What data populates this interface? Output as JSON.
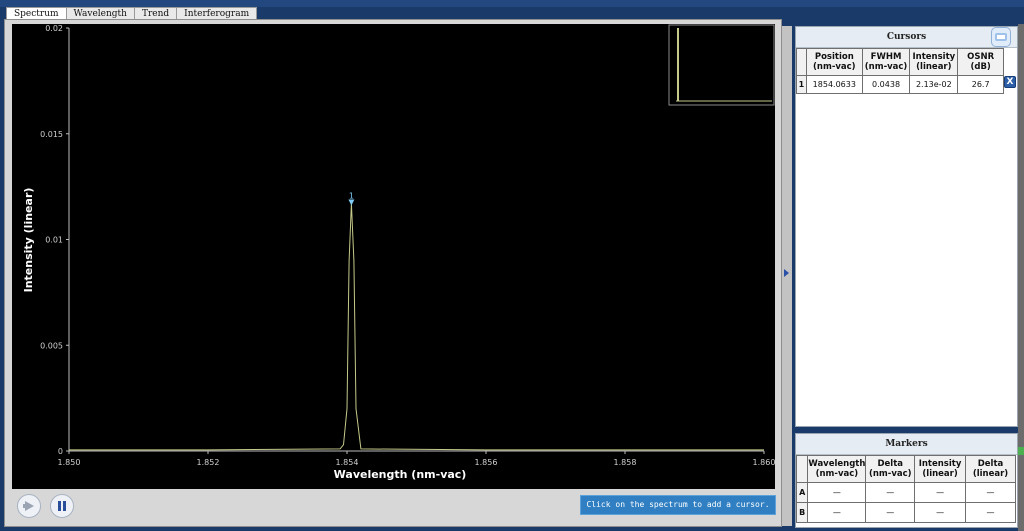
{
  "tabs": [
    "Spectrum",
    "Wavelength",
    "Trend",
    "Interferogram"
  ],
  "plot": {
    "ylabel": "Intensity (linear)",
    "xlabel": "Wavelength (nm-vac)",
    "yticks": [
      "0",
      "0.005",
      "0.01",
      "0.015",
      "0.02"
    ],
    "xticks": [
      "1.850",
      "1.852",
      "1.854",
      "1.856",
      "1.858",
      "1.860"
    ],
    "peak_marker_label": "1",
    "colors": {
      "background": "#000000",
      "trace": "#c6c98a",
      "marker": "#7ecaf3"
    }
  },
  "chart_data": {
    "type": "line",
    "xlabel": "Wavelength (nm-vac)",
    "ylabel": "Intensity (linear)",
    "xlim": [
      1850,
      1860
    ],
    "ylim": [
      0,
      0.02
    ],
    "x": [
      1850.0,
      1852.0,
      1853.9,
      1853.95,
      1854.0,
      1854.03,
      1854.0633,
      1854.1,
      1854.13,
      1854.2,
      1856.0,
      1858.0,
      1860.0
    ],
    "y": [
      5e-05,
      5e-05,
      0.0001,
      0.0003,
      0.002,
      0.009,
      0.0117,
      0.009,
      0.002,
      0.0001,
      5e-05,
      5e-05,
      5e-05
    ]
  },
  "controls": {
    "play_icon": "play-icon",
    "pause_icon": "pause-icon",
    "status_text": "Click on the spectrum to add a cursor."
  },
  "cursors": {
    "title": "Cursors",
    "headers": [
      [
        "Position",
        "(nm-vac)"
      ],
      [
        "FWHM",
        "(nm-vac)"
      ],
      [
        "Intensity",
        "(linear)"
      ],
      [
        "OSNR",
        "(dB)"
      ]
    ],
    "rows": [
      {
        "index": "1",
        "position": "1854.0633",
        "fwhm": "0.0438",
        "intensity": "2.13e-02",
        "osnr": "26.7",
        "remove_label": "X"
      }
    ]
  },
  "markers": {
    "title": "Markers",
    "headers": [
      [
        "Wavelength",
        "(nm-vac)"
      ],
      [
        "Delta",
        "(nm-vac)"
      ],
      [
        "Intensity",
        "(linear)"
      ],
      [
        "Delta",
        "(linear)"
      ]
    ],
    "rows": [
      {
        "label": "A",
        "values": [
          "—",
          "—",
          "—",
          "—"
        ]
      },
      {
        "label": "B",
        "values": [
          "—",
          "—",
          "—",
          "—"
        ]
      }
    ]
  }
}
